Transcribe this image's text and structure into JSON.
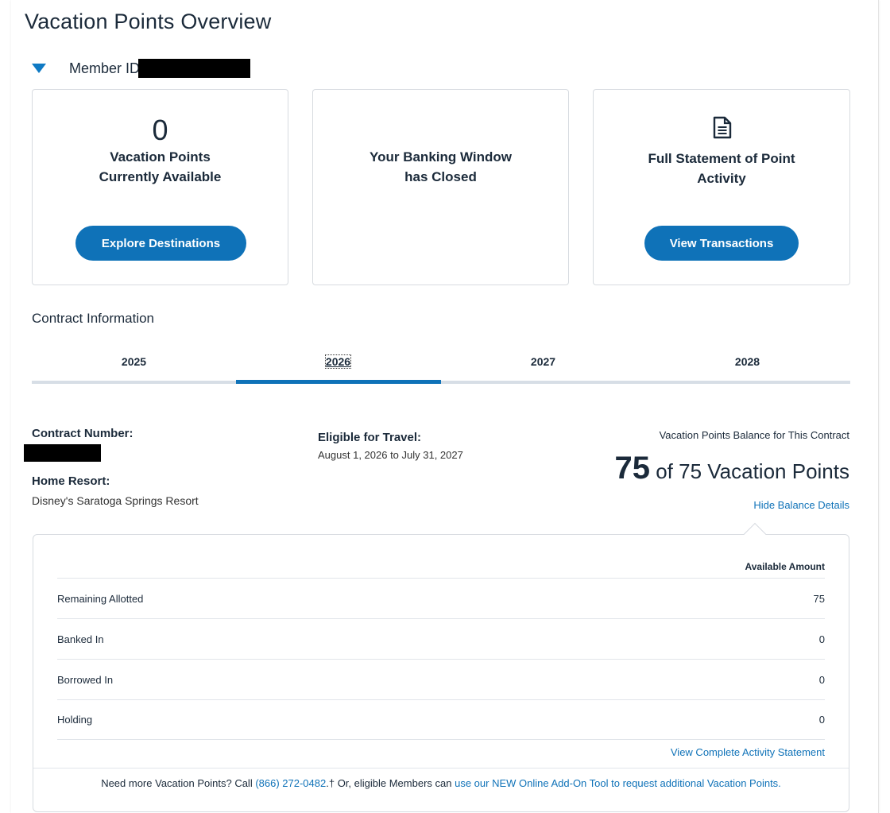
{
  "page": {
    "title": "Vacation Points Overview"
  },
  "member": {
    "label": "Member ID"
  },
  "cards": {
    "points": {
      "number": "0",
      "text": "Vacation Points\nCurrently Available",
      "button": "Explore Destinations"
    },
    "banking": {
      "text": "Your Banking Window\nhas Closed"
    },
    "statement": {
      "text": "Full Statement of Point\nActivity",
      "button": "View Transactions",
      "icon": "document-icon"
    }
  },
  "contract_section": {
    "label": "Contract Information"
  },
  "tabs": [
    "2025",
    "2026",
    "2027",
    "2028"
  ],
  "active_tab": "2026",
  "contract": {
    "number_label": "Contract Number:",
    "home_resort_label": "Home Resort:",
    "home_resort": "Disney's Saratoga Springs Resort",
    "eligible_label": "Eligible for Travel:",
    "eligible_dates": "August 1, 2026 to July 31, 2027",
    "balance_label": "Vacation Points Balance for This Contract",
    "balance_num": "75",
    "balance_text": "of 75 Vacation Points",
    "hide_link": "Hide Balance Details"
  },
  "details": {
    "column_header": "Available Amount",
    "rows": [
      {
        "label": "Remaining Allotted",
        "amount": "75"
      },
      {
        "label": "Banked In",
        "amount": "0"
      },
      {
        "label": "Borrowed In",
        "amount": "0"
      },
      {
        "label": "Holding",
        "amount": "0"
      }
    ],
    "view_complete": "View Complete Activity Statement",
    "footer_prefix": "Need more Vacation Points? Call ",
    "footer_phone": "(866) 272-0482",
    "footer_middle": ".† Or, eligible Members can ",
    "footer_link": "use our NEW Online Add-On Tool to request additional Vacation Points."
  },
  "colors": {
    "accent": "#0f72b8",
    "text": "#1b2a3a",
    "border": "#d7dbe0"
  }
}
